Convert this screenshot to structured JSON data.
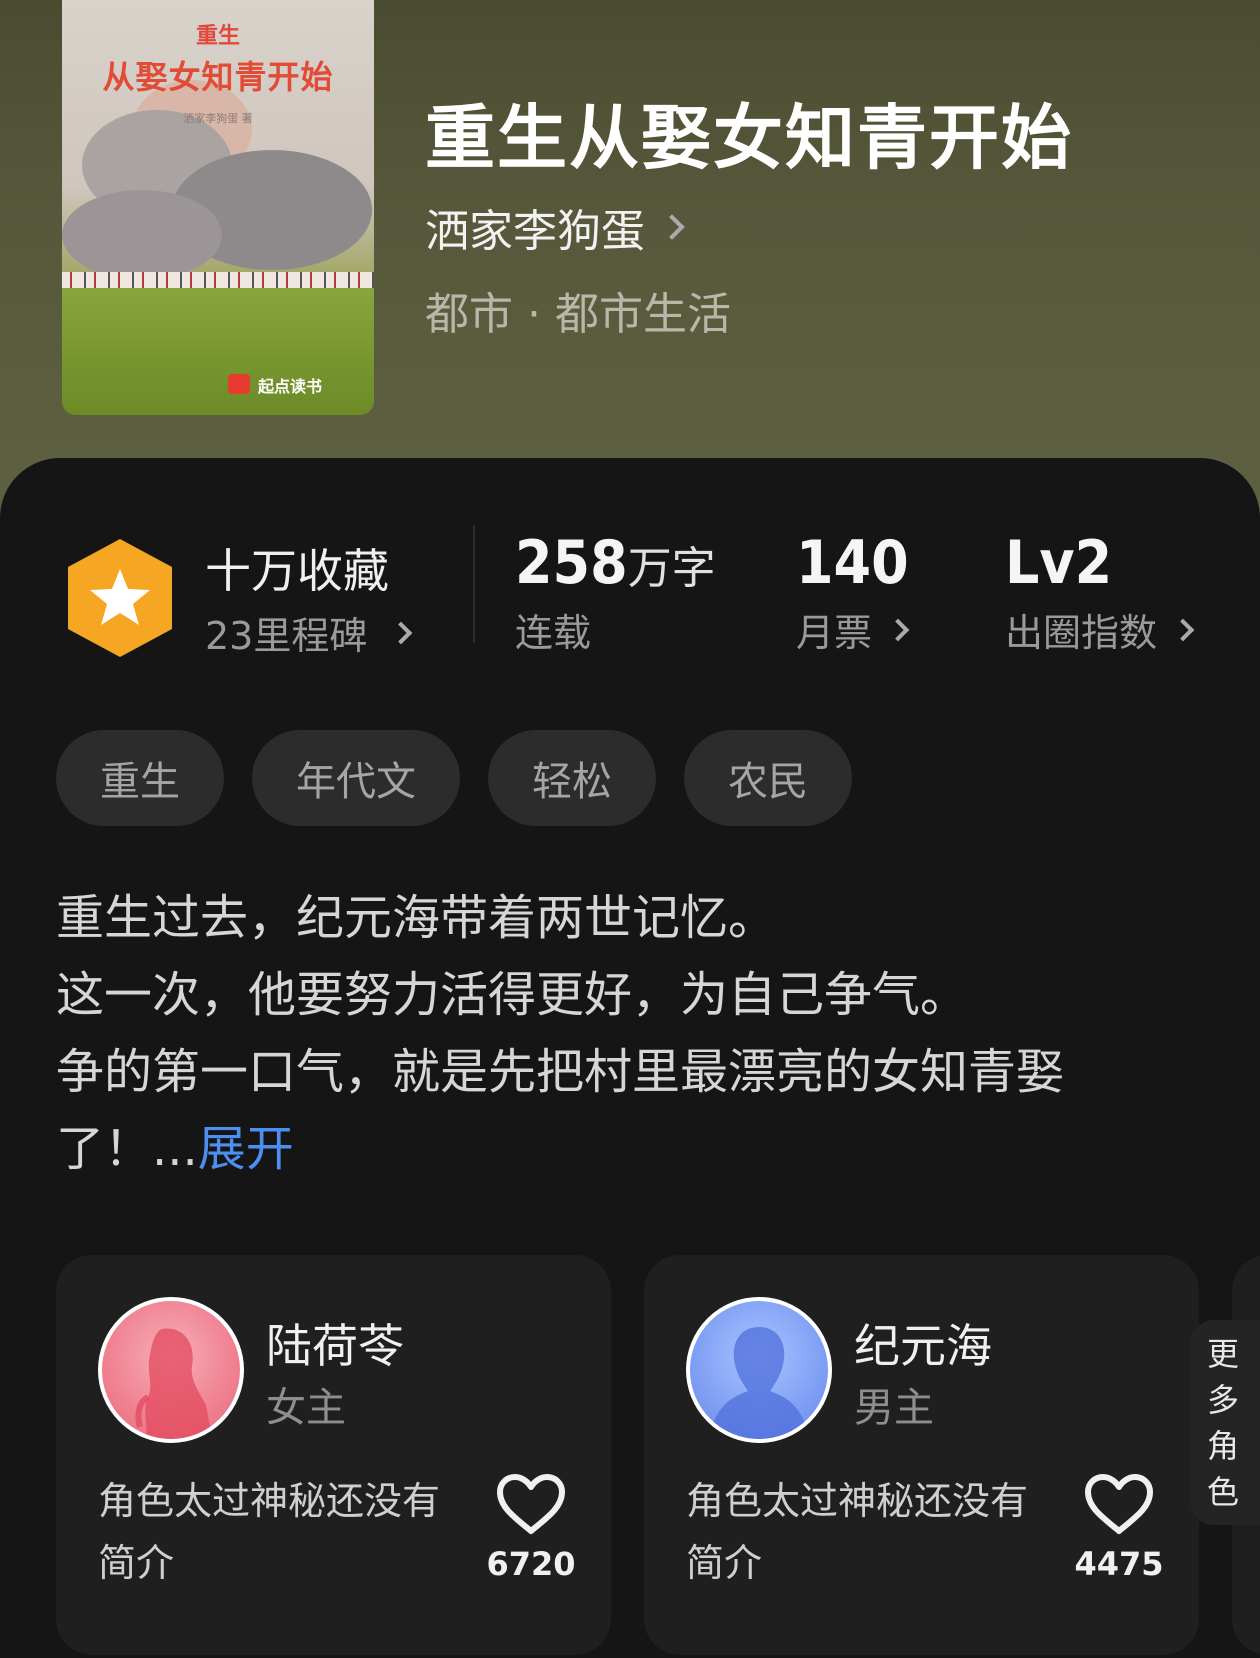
{
  "book": {
    "title": "重生从娶女知青开始",
    "author": "洒家李狗蛋",
    "genre": "都市 · 都市生活",
    "cover": {
      "subtitle": "重生",
      "title": "从娶女知青开始",
      "author_small": "洒家李狗蛋 著",
      "brand": "起点读书"
    }
  },
  "stats": {
    "milestone": {
      "title": "十万收藏",
      "subtitle": "23里程碑"
    },
    "word_count": {
      "value": "258",
      "unit": "万字",
      "label": "连载"
    },
    "monthly_tickets": {
      "value": "140",
      "label": "月票"
    },
    "breakout_index": {
      "value": "Lv2",
      "label": "出圈指数"
    }
  },
  "tags": [
    "重生",
    "年代文",
    "轻松",
    "农民"
  ],
  "description": {
    "lines": [
      "重生过去，纪元海带着两世记忆。",
      "这一次，他要努力活得更好，为自己争气。",
      "争的第一口气，就是先把村里最漂亮的女知青娶",
      "了！..."
    ],
    "expand_label": "展开"
  },
  "characters": [
    {
      "name": "陆荷苓",
      "role": "女主",
      "intro": "角色太过神秘还没有简介",
      "likes": "6720",
      "avatar_color": "#f08090"
    },
    {
      "name": "纪元海",
      "role": "男主",
      "intro": "角色太过神秘还没有简介",
      "likes": "4475",
      "avatar_color": "#7f9ff4"
    }
  ],
  "more_roles": {
    "chars": [
      "更",
      "多",
      "角",
      "色"
    ]
  },
  "colors": {
    "accent_link": "#4d8ff0",
    "medal": "#f5a623",
    "hero_bg": "#57583b"
  }
}
